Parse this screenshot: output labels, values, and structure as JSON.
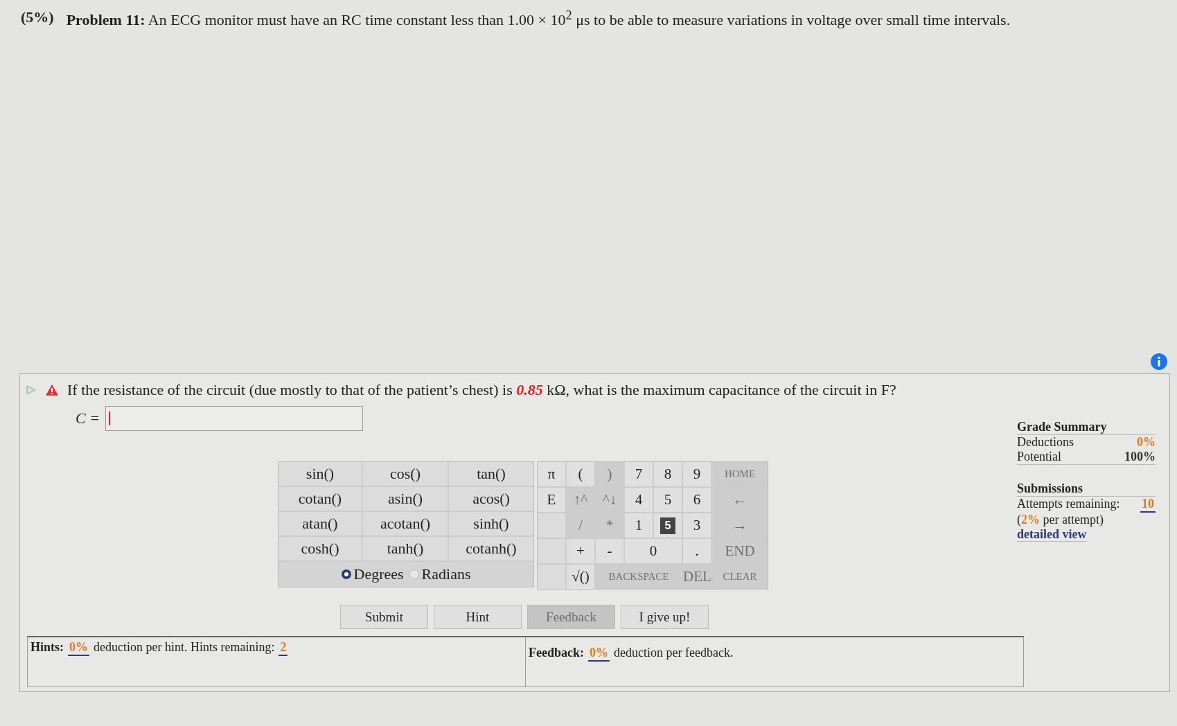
{
  "problem": {
    "weight": "(5%)",
    "label": "Problem 11:",
    "text": "An ECG monitor must have an RC time constant less than 1.00 × 10$^{2}$ μs to be able to measure variations in voltage over small time intervals."
  },
  "question": {
    "text": "If the resistance of the circuit (due mostly to that of the patient’s chest) is **0.85** kΩ, what is the maximum capacitance of the circuit in F?",
    "answer_label": "C ="
  },
  "functions": [
    [
      "sin()",
      "cos()",
      "tan()"
    ],
    [
      "cotan()",
      "asin()",
      "acos()"
    ],
    [
      "atan()",
      "acotan()",
      "sinh()"
    ],
    [
      "cosh()",
      "tanh()",
      "cotanh()"
    ]
  ],
  "angle_modes": [
    {
      "label": "Degrees",
      "selected": true
    },
    {
      "label": "Radians",
      "selected": false
    }
  ],
  "keypad": [
    [
      {
        "kind": "key",
        "label": "π",
        "disabled": false
      },
      {
        "kind": "key",
        "label": "(",
        "disabled": false
      },
      {
        "kind": "key",
        "label": ")",
        "disabled": true
      },
      {
        "kind": "key",
        "label": "7",
        "disabled": false
      },
      {
        "kind": "key",
        "label": "8",
        "disabled": false
      },
      {
        "kind": "key",
        "label": "9",
        "disabled": false
      },
      {
        "kind": "key",
        "label": "HOME",
        "disabled": true
      }
    ],
    [
      {
        "kind": "key",
        "label": "E",
        "disabled": false
      },
      {
        "kind": "key",
        "label": "↑^",
        "disabled": true
      },
      {
        "kind": "key",
        "label": "^↓",
        "disabled": true
      },
      {
        "kind": "key",
        "label": "4",
        "disabled": false
      },
      {
        "kind": "key",
        "label": "5",
        "disabled": false
      },
      {
        "kind": "key",
        "label": "6",
        "disabled": false
      },
      {
        "kind": "key",
        "label": "←",
        "disabled": true
      }
    ],
    [
      {
        "kind": "blank"
      },
      {
        "kind": "key",
        "label": "/",
        "disabled": true
      },
      {
        "kind": "key",
        "label": "*",
        "disabled": true
      },
      {
        "kind": "key",
        "label": "1",
        "disabled": false
      },
      {
        "kind": "tooltip",
        "label": "5"
      },
      {
        "kind": "key",
        "label": "3",
        "disabled": false
      },
      {
        "kind": "key",
        "label": "→",
        "disabled": true
      }
    ],
    [
      {
        "kind": "blank"
      },
      {
        "kind": "key",
        "label": "+",
        "disabled": false
      },
      {
        "kind": "key",
        "label": "-",
        "disabled": false
      },
      {
        "kind": "double",
        "label": "0",
        "disabled": false
      },
      {
        "kind": "key",
        "label": ".",
        "disabled": false
      },
      {
        "kind": "key",
        "label": "END",
        "disabled": true
      }
    ],
    [
      {
        "kind": "blank"
      },
      {
        "kind": "key",
        "label": "√()",
        "disabled": false
      },
      {
        "kind": "triple",
        "label": "BACKSPACE",
        "disabled": true
      },
      {
        "kind": "key",
        "label": "DEL",
        "disabled": true
      },
      {
        "kind": "key",
        "label": "CLEAR",
        "disabled": true
      }
    ]
  ],
  "buttons": [
    {
      "label": "Submit",
      "disabled": false
    },
    {
      "label": "Hint",
      "disabled": false
    },
    {
      "label": "Feedback",
      "disabled": true
    },
    {
      "label": "I give up!",
      "disabled": false
    }
  ],
  "hints": {
    "label": "Hints:",
    "deduction": "0%",
    "text": "deduction per hint. Hints remaining:",
    "remaining": "2"
  },
  "feedback": {
    "label": "Feedback:",
    "deduction": "0%",
    "text": "deduction per feedback."
  },
  "grade_summary": {
    "title": "Grade Summary",
    "rows": [
      {
        "label": "Deductions",
        "value": "0%",
        "kind": "deduction"
      },
      {
        "label": "Potential",
        "value": "100%",
        "kind": "plain"
      }
    ]
  },
  "submissions": {
    "title": "Submissions",
    "attempts_label": "Attempts remaining:",
    "attempts": "10",
    "penalty": "(**2%** per attempt)",
    "link": "detailed view"
  }
}
